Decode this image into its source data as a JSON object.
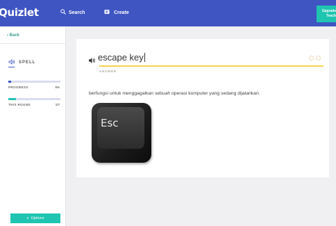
{
  "topbar": {
    "logo": "Quizlet",
    "search_label": "Search",
    "create_label": "Create",
    "upgrade_label": "Upgrade\nTeach",
    "upgrade_lines": [
      "Upgrade",
      "Teach"
    ],
    "color": "#3f55c2"
  },
  "sidebar": {
    "back_label": "Back",
    "mode_label": "SPELL",
    "progress": {
      "label": "PROGRESS",
      "value": "5%",
      "fraction": 0.05,
      "color": "#3f55c2"
    },
    "round": {
      "label": "THIS ROUND",
      "value": "1/7",
      "fraction": 0.143,
      "color": "#1fc5b0"
    },
    "options_label": "Options",
    "accent": "#1fc5b0"
  },
  "card": {
    "term": "escape key",
    "answer_label": "ANSWER",
    "definition": "berfungsi untuk menggagalkan sebuah operasi komputer yang sedang dijalankan.",
    "key_label": "Esc",
    "answer_line_color": "#f3d34a"
  },
  "icons": {
    "search": "search-icon",
    "create": "create-icon",
    "back": "chevron-left-icon",
    "spell": "speaker-spell-icon",
    "speaker": "speaker-icon",
    "options": "list-icon"
  }
}
